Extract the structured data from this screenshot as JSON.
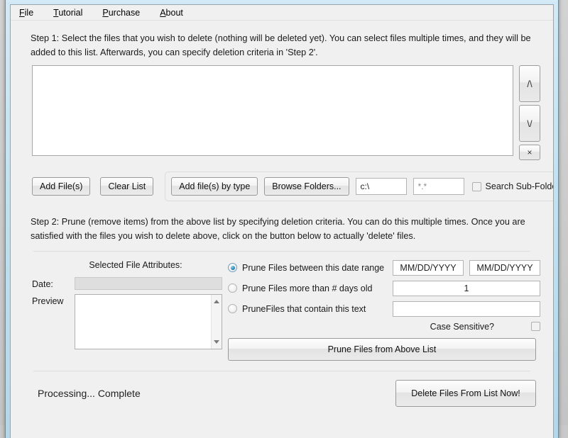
{
  "window": {
    "icon": "app-icon"
  },
  "menu": {
    "items": [
      {
        "label": "File",
        "accel": "F",
        "rest": "ile"
      },
      {
        "label": "Tutorial",
        "accel": "T",
        "rest": "utorial"
      },
      {
        "label": "Purchase",
        "accel": "P",
        "rest": "urchase"
      },
      {
        "label": "About",
        "accel": "A",
        "rest": "bout"
      }
    ]
  },
  "step1": {
    "instructions": "Step 1: Select the files that you wish to delete (nothing will be deleted yet). You can select files multiple times, and they will be added to this list. Afterwards, you can specify deletion criteria in 'Step 2'.",
    "list_items": [],
    "side_buttons": {
      "move_up": "/\\",
      "move_down": "\\/",
      "remove": "×"
    },
    "buttons": {
      "add_files": "Add File(s)",
      "clear_list": "Clear List",
      "add_by_type": "Add file(s) by type",
      "browse_folders": "Browse Folders..."
    },
    "fields": {
      "path_value": "c:\\",
      "path_placeholder": "c:\\",
      "mask_value": "*.*",
      "mask_placeholder": "*.*"
    },
    "search_subfolders": {
      "label": "Search Sub-Folders",
      "checked": false
    }
  },
  "step2": {
    "instructions": "Step 2: Prune (remove items) from  the above list by specifying deletion criteria. You can do this multiple times. Once you are satisfied with the files you wish to delete above, click on the button below to actually 'delete' files.",
    "attributes": {
      "title": "Selected File Attributes:",
      "date_label": "Date:",
      "date_value": "",
      "preview_label": "Preview",
      "preview_value": ""
    },
    "criteria": {
      "options": [
        {
          "label": "Prune Files between this date range",
          "selected": true
        },
        {
          "label": "Prune Files more than # days old",
          "selected": false
        },
        {
          "label": "PruneFiles that contain this text",
          "selected": false
        }
      ],
      "date_from_value": "MM/DD/YYYY",
      "date_to_value": "MM/DD/YYYY",
      "days_old_value": "1",
      "contains_text_value": "",
      "case_sensitive_label": "Case Sensitive?",
      "case_sensitive_checked": false
    },
    "prune_button": "Prune Files from Above List"
  },
  "footer": {
    "status": "Processing... Complete",
    "delete_button": "Delete Files From List Now!"
  },
  "colors": {
    "accent_radio": "#2a86b8",
    "window_frame": "#b2d8ec",
    "client_bg": "#f0f0f0",
    "field_bg": "#ffffff",
    "disabled_field": "#dedede"
  }
}
